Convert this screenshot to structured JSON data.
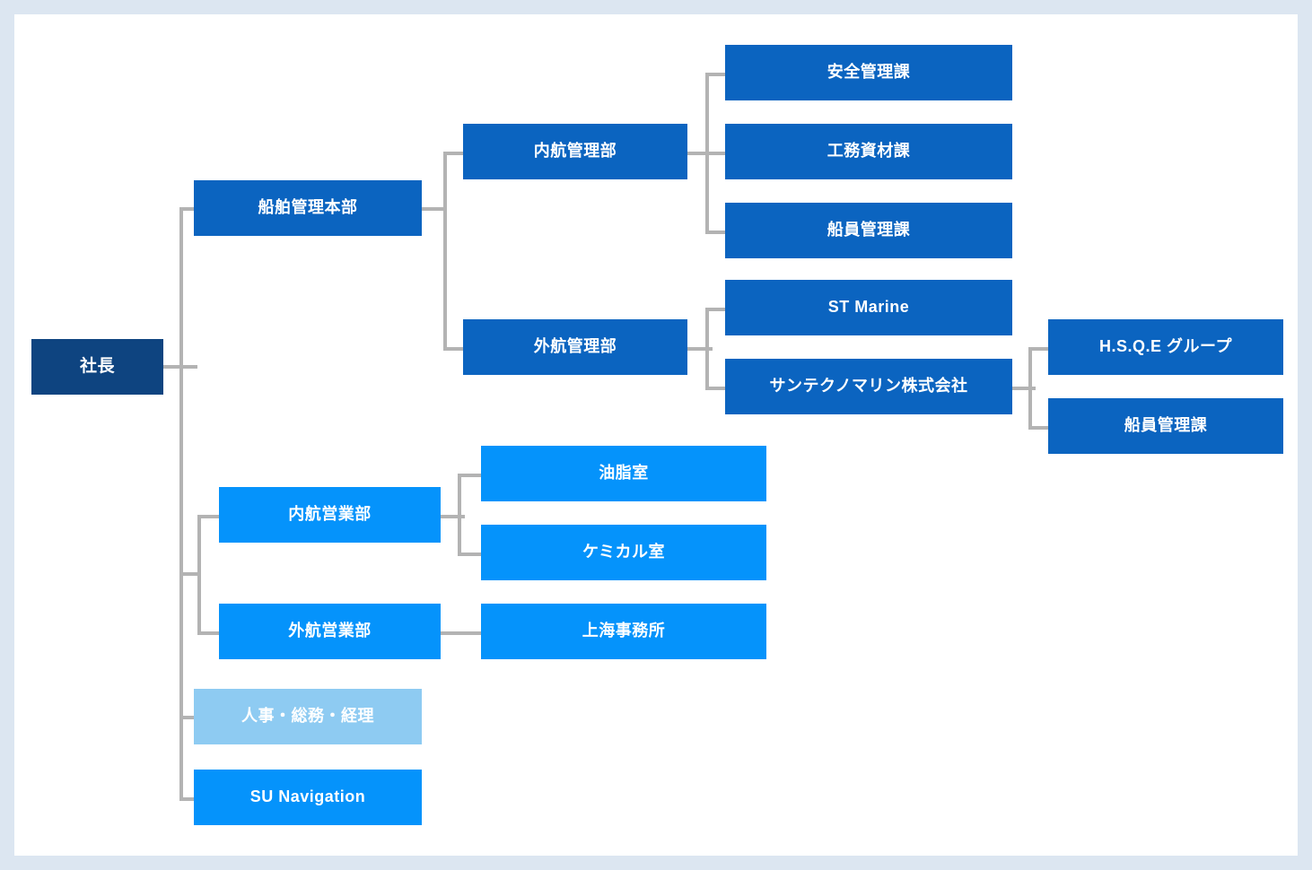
{
  "chart": {
    "type": "org-chart",
    "title": "",
    "colors": {
      "root": "#0e4480",
      "level_blue": "#0b64c0",
      "level_bright": "#0593fb",
      "level_light": "#8ecbf2",
      "connector": "#b3b3b3",
      "page_background": "#dce6f1",
      "canvas_background": "#ffffff",
      "text": "#ffffff"
    },
    "nodes": {
      "president": {
        "label": "社長",
        "color": "#0e4480",
        "level": 0
      },
      "ship_mgmt_hq": {
        "label": "船舶管理本部",
        "color": "#0b64c0",
        "level": 1
      },
      "domestic_mgmt": {
        "label": "内航管理部",
        "color": "#0b64c0",
        "level": 2
      },
      "safety_mgmt": {
        "label": "安全管理課",
        "color": "#0b64c0",
        "level": 3
      },
      "engineering_materials": {
        "label": "工務資材課",
        "color": "#0b64c0",
        "level": 3
      },
      "crew_mgmt": {
        "label": "船員管理課",
        "color": "#0b64c0",
        "level": 3
      },
      "ocean_mgmt": {
        "label": "外航管理部",
        "color": "#0b64c0",
        "level": 2
      },
      "st_marine": {
        "label": "ST Marine",
        "color": "#0b64c0",
        "level": 3
      },
      "santechno_marine": {
        "label": "サンテクノマリン株式会社",
        "color": "#0b64c0",
        "level": 3
      },
      "hsqe_group": {
        "label": "H.S.Q.E グループ",
        "color": "#0b64c0",
        "level": 4
      },
      "crew_mgmt_2": {
        "label": "船員管理課",
        "color": "#0b64c0",
        "level": 4
      },
      "domestic_sales": {
        "label": "内航営業部",
        "color": "#0593fb",
        "level": 1
      },
      "oils_room": {
        "label": "油脂室",
        "color": "#0593fb",
        "level": 2
      },
      "chemical_room": {
        "label": "ケミカル室",
        "color": "#0593fb",
        "level": 2
      },
      "ocean_sales": {
        "label": "外航営業部",
        "color": "#0593fb",
        "level": 1
      },
      "shanghai_office": {
        "label": "上海事務所",
        "color": "#0593fb",
        "level": 2
      },
      "hr_admin_accounting": {
        "label": "人事・総務・経理",
        "color": "#8ecbf2",
        "level": 1
      },
      "su_navigation": {
        "label": "SU Navigation",
        "color": "#0593fb",
        "level": 1
      }
    },
    "edges": [
      {
        "from": "president",
        "to": "ship_mgmt_hq"
      },
      {
        "from": "president",
        "to": "domestic_sales"
      },
      {
        "from": "president",
        "to": "ocean_sales"
      },
      {
        "from": "president",
        "to": "hr_admin_accounting"
      },
      {
        "from": "president",
        "to": "su_navigation"
      },
      {
        "from": "ship_mgmt_hq",
        "to": "domestic_mgmt"
      },
      {
        "from": "ship_mgmt_hq",
        "to": "ocean_mgmt"
      },
      {
        "from": "domestic_mgmt",
        "to": "safety_mgmt"
      },
      {
        "from": "domestic_mgmt",
        "to": "engineering_materials"
      },
      {
        "from": "domestic_mgmt",
        "to": "crew_mgmt"
      },
      {
        "from": "ocean_mgmt",
        "to": "st_marine"
      },
      {
        "from": "ocean_mgmt",
        "to": "santechno_marine"
      },
      {
        "from": "santechno_marine",
        "to": "hsqe_group"
      },
      {
        "from": "santechno_marine",
        "to": "crew_mgmt_2"
      },
      {
        "from": "domestic_sales",
        "to": "oils_room"
      },
      {
        "from": "domestic_sales",
        "to": "chemical_room"
      },
      {
        "from": "ocean_sales",
        "to": "shanghai_office"
      }
    ]
  }
}
